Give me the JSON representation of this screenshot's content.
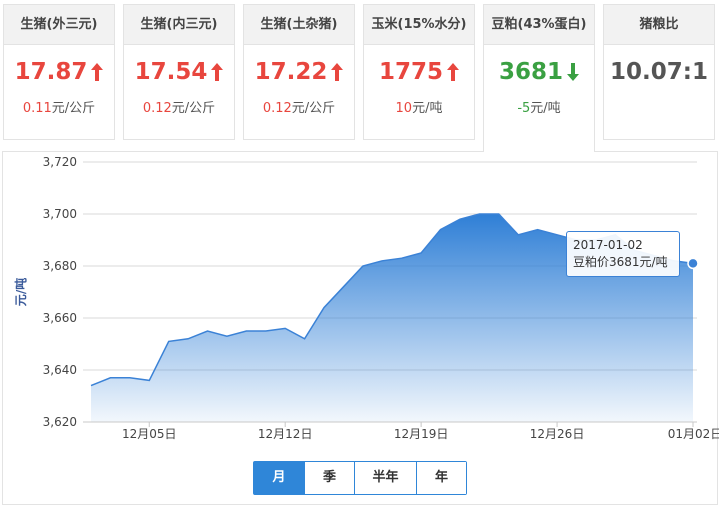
{
  "cards": [
    {
      "title": "生猪(外三元)",
      "price": "17.87",
      "dir": "up",
      "change_num": "0.11",
      "unit": "元/公斤"
    },
    {
      "title": "生猪(内三元)",
      "price": "17.54",
      "dir": "up",
      "change_num": "0.12",
      "unit": "元/公斤"
    },
    {
      "title": "生猪(土杂猪)",
      "price": "17.22",
      "dir": "up",
      "change_num": "0.12",
      "unit": "元/公斤"
    },
    {
      "title": "玉米(15%水分)",
      "price": "1775",
      "dir": "up",
      "change_num": "10",
      "unit": "元/吨"
    },
    {
      "title": "豆粕(43%蛋白)",
      "price": "3681",
      "dir": "down",
      "change_num": "-5",
      "unit": "元/吨"
    },
    {
      "title": "猪粮比",
      "price": "10.07:1",
      "dir": "none",
      "change_num": "",
      "unit": ""
    }
  ],
  "colors": {
    "up": "#e8463e",
    "down": "#3aa042",
    "line": "#3b82d6",
    "accent": "#2f86d8"
  },
  "tooltip": {
    "date": "2017-01-02",
    "label": "豆粕价3681元/吨"
  },
  "periods": [
    "月",
    "季",
    "半年",
    "年"
  ],
  "active_period": "月",
  "chart_data": {
    "type": "area",
    "ylabel": "元/吨",
    "ylim": [
      3620,
      3720
    ],
    "yticks": [
      3620,
      3640,
      3660,
      3680,
      3700,
      3720
    ],
    "ytick_labels": [
      "3,620",
      "3,640",
      "3,660",
      "3,680",
      "3,700",
      "3,720"
    ],
    "xtick_labels": [
      "12月05日",
      "12月12日",
      "12月19日",
      "12月26日",
      "01月02日"
    ],
    "xtick_index": [
      3,
      10,
      17,
      24,
      31
    ],
    "grid": true,
    "x": [
      "2016-12-02",
      "2016-12-03",
      "2016-12-04",
      "2016-12-05",
      "2016-12-06",
      "2016-12-07",
      "2016-12-08",
      "2016-12-09",
      "2016-12-10",
      "2016-12-11",
      "2016-12-12",
      "2016-12-13",
      "2016-12-14",
      "2016-12-15",
      "2016-12-16",
      "2016-12-17",
      "2016-12-18",
      "2016-12-19",
      "2016-12-20",
      "2016-12-21",
      "2016-12-22",
      "2016-12-23",
      "2016-12-24",
      "2016-12-25",
      "2016-12-26",
      "2016-12-27",
      "2016-12-28",
      "2016-12-29",
      "2016-12-30",
      "2016-12-31",
      "2017-01-01",
      "2017-01-02"
    ],
    "values": [
      3634,
      3637,
      3637,
      3636,
      3651,
      3652,
      3655,
      3653,
      3655,
      3655,
      3656,
      3652,
      3664,
      3672,
      3680,
      3682,
      3683,
      3685,
      3694,
      3698,
      3700,
      3700,
      3692,
      3694,
      3692,
      3690,
      3690,
      3692,
      3686,
      3684,
      3682,
      3681
    ],
    "highlight_index": 31
  }
}
